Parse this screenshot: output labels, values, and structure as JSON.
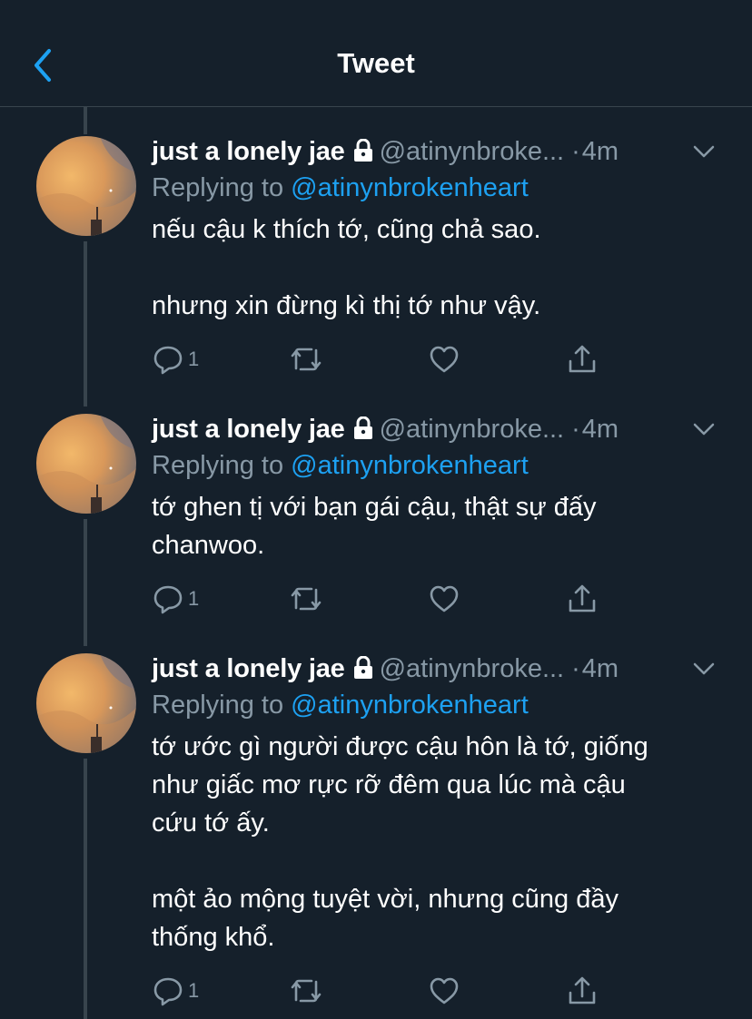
{
  "header": {
    "title": "Tweet",
    "back_icon": "chevron-left-icon",
    "accent": "#1da1f2"
  },
  "colors": {
    "background": "#15202b",
    "muted": "#8899a6",
    "link": "#1da1f2",
    "divider": "#38444d"
  },
  "tweets": [
    {
      "display_name": "just a lonely jae",
      "handle": "@atinynbroke...",
      "dot": "·",
      "time": "4m",
      "replying_prefix": "Replying to",
      "replying_to": "@atinynbrokenheart",
      "text": "nếu cậu k thích tớ, cũng chả sao.\n\nnhưng xin đừng kì thị tớ như vậy.",
      "reply_count": "1"
    },
    {
      "display_name": "just a lonely jae",
      "handle": "@atinynbroke...",
      "dot": "·",
      "time": "4m",
      "replying_prefix": "Replying to",
      "replying_to": "@atinynbrokenheart",
      "text": "tớ ghen tị với bạn gái cậu, thật sự đấy\nchanwoo.",
      "reply_count": "1"
    },
    {
      "display_name": "just a lonely jae",
      "handle": "@atinynbroke...",
      "dot": "·",
      "time": "4m",
      "replying_prefix": "Replying to",
      "replying_to": "@atinynbrokenheart",
      "text": "tớ ước gì người được cậu hôn là tớ, giống\nnhư giấc mơ rực rỡ đêm qua lúc mà cậu\ncứu tớ ấy.\n\nmột ảo mộng tuyệt vời, nhưng cũng đầy\nthống khổ.",
      "reply_count": "1"
    }
  ]
}
